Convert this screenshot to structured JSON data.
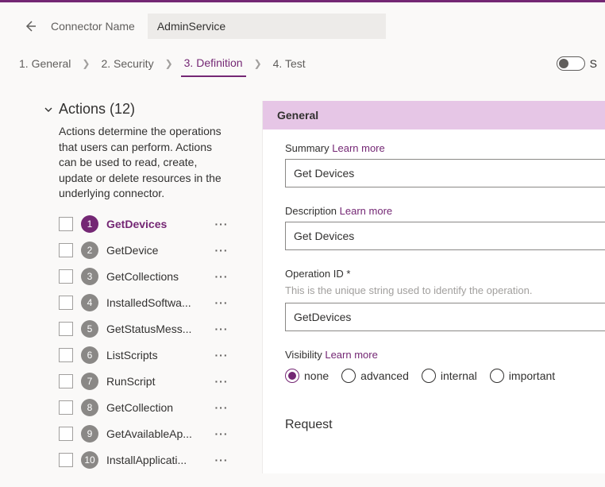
{
  "header": {
    "connector_label": "Connector Name",
    "connector_value": "AdminService"
  },
  "tabs": {
    "items": [
      {
        "label": "1. General"
      },
      {
        "label": "2. Security"
      },
      {
        "label": "3. Definition"
      },
      {
        "label": "4. Test"
      }
    ]
  },
  "actions": {
    "title": "Actions (12)",
    "description": "Actions determine the operations that users can perform. Actions can be used to read, create, update or delete resources in the underlying connector.",
    "items": [
      {
        "n": "1",
        "label": "GetDevices",
        "active": true
      },
      {
        "n": "2",
        "label": "GetDevice"
      },
      {
        "n": "3",
        "label": "GetCollections"
      },
      {
        "n": "4",
        "label": "InstalledSoftwa..."
      },
      {
        "n": "5",
        "label": "GetStatusMess..."
      },
      {
        "n": "6",
        "label": "ListScripts"
      },
      {
        "n": "7",
        "label": "RunScript"
      },
      {
        "n": "8",
        "label": "GetCollection"
      },
      {
        "n": "9",
        "label": "GetAvailableAp..."
      },
      {
        "n": "10",
        "label": "InstallApplicati..."
      }
    ]
  },
  "general": {
    "section_title": "General",
    "summary_label": "Summary",
    "learn_more": "Learn more",
    "summary_value": "Get Devices",
    "description_label": "Description",
    "description_value": "Get Devices",
    "opid_label": "Operation ID *",
    "opid_hint": "This is the unique string used to identify the operation.",
    "opid_value": "GetDevices",
    "visibility_label": "Visibility",
    "visibility_options": [
      "none",
      "advanced",
      "internal",
      "important"
    ],
    "visibility_selected": "none"
  },
  "request": {
    "title": "Request"
  }
}
